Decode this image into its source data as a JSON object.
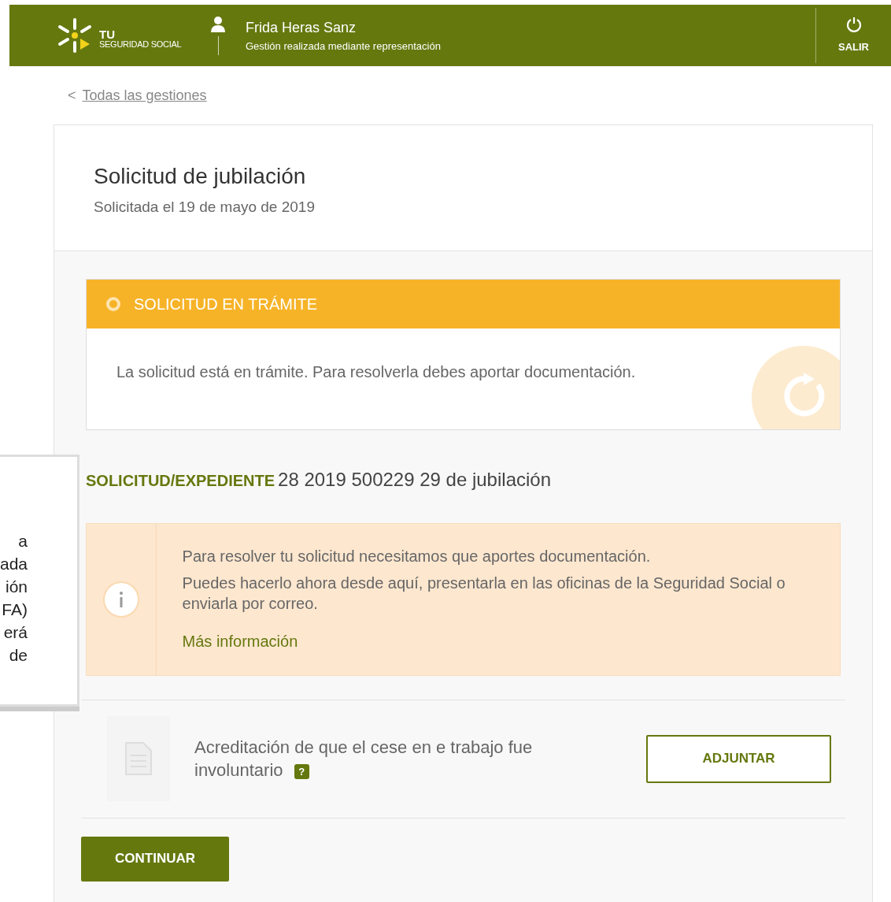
{
  "header": {
    "logo_top": "TU",
    "logo_bottom": "SEGURIDAD SOCIAL",
    "user_name": "Frida Heras Sanz",
    "user_note": "Gestión realizada mediante representación",
    "logout": "SALIR"
  },
  "back_link": {
    "caret": "<",
    "label": "Todas las gestiones"
  },
  "request": {
    "title": "Solicitud de jubilación",
    "subtitle": "Solicitada el 19 de mayo de 2019"
  },
  "status": {
    "label": "SOLICITUD EN TRÁMITE",
    "message": "La solicitud está en trámite. Para resolverla debes aportar documentación."
  },
  "file": {
    "label": "SOLICITUD/EXPEDIENTE",
    "value": "28 2019 500229 29 de jubilación"
  },
  "info": {
    "lines": [
      "Para resolver tu solicitud necesitamos que aportes documentación.",
      "Puedes hacerlo ahora desde aquí, presentarla en las oficinas de la Seguridad Social o enviarla por correo."
    ],
    "link": "Más información"
  },
  "documents": [
    {
      "text": "Acreditación de que el cese en e trabajo fue involuntario",
      "help": "?",
      "button": "ADJUNTAR"
    }
  ],
  "continue": "CONTINUAR",
  "popover": {
    "lines": [
      "a",
      "ada",
      "ión",
      "FA)",
      "erá",
      "de"
    ]
  }
}
